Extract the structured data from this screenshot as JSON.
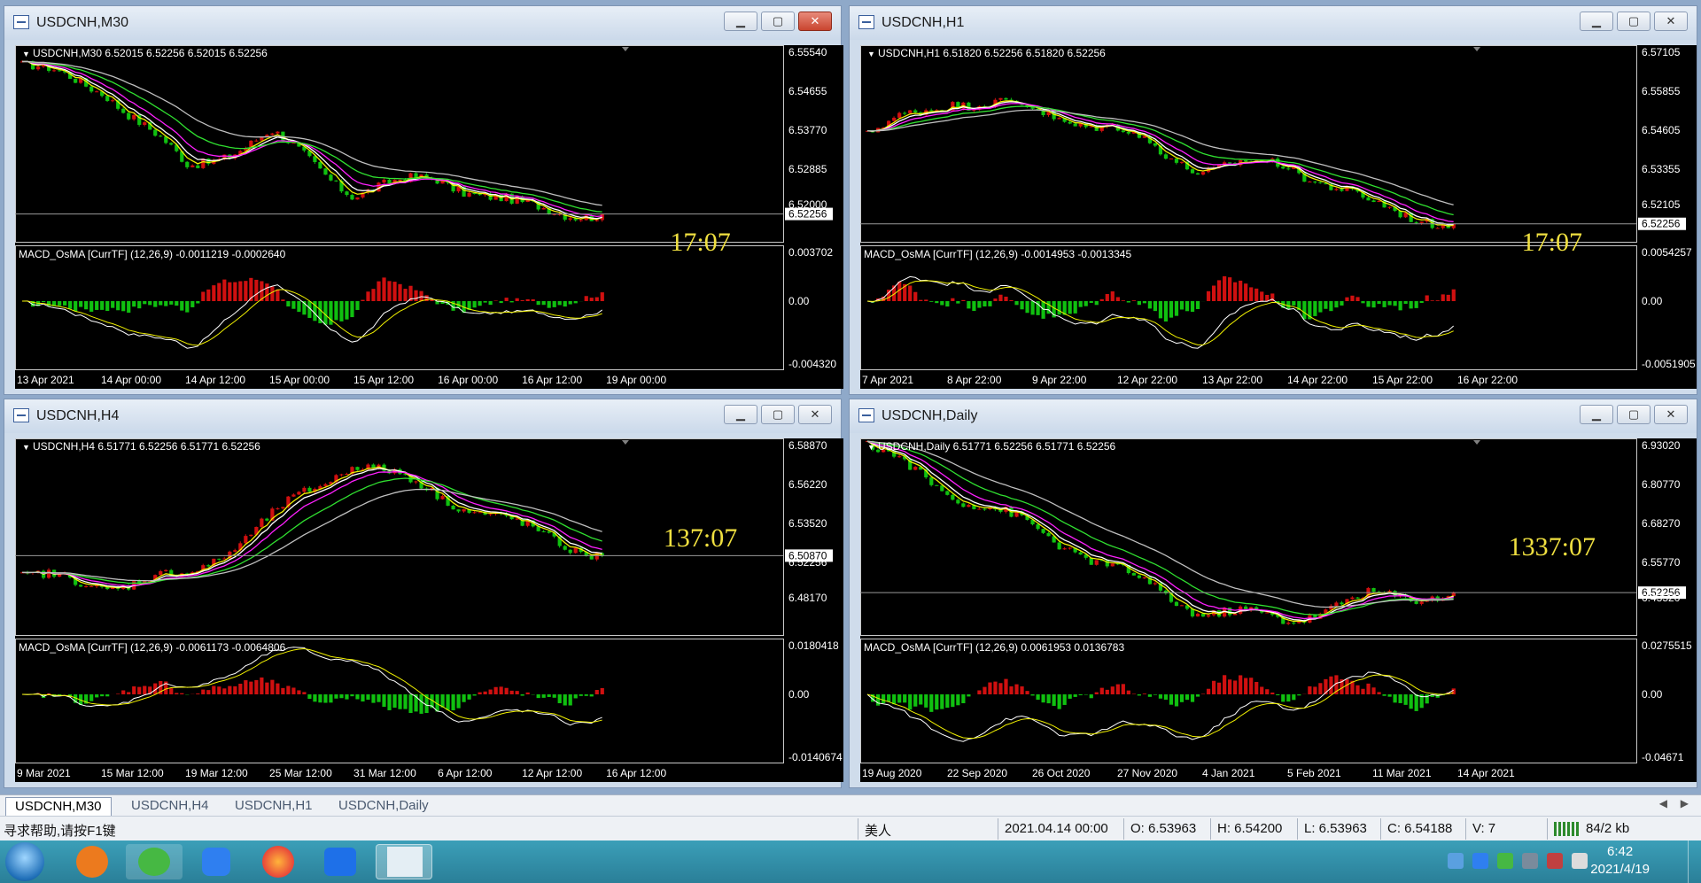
{
  "colors": {
    "bull": "#d01010",
    "bear": "#10c010",
    "ma_yellow": "#f0f000",
    "ma_white": "#ffffff",
    "ma_magenta": "#ff20ff",
    "ma_green": "#30e030",
    "ma_gray": "#bfbfbf",
    "countdown": "#f0e040"
  },
  "windows": [
    {
      "id": "m30",
      "title": "USDCNH,M30",
      "price_label": "USDCNH,M30  6.52015 6.52256 6.52015 6.52256",
      "price_axis": [
        "6.55540",
        "6.54655",
        "6.53770",
        "6.52885",
        "6.52256",
        "6.52000"
      ],
      "countdown": "17:07",
      "macd_label": "MACD_OsMA [CurrTF] (12,26,9) -0.0011219 -0.0002640",
      "macd_axis": [
        "0.003702",
        "0.00",
        "-0.004320"
      ],
      "time_axis": [
        "13 Apr 2021",
        "14 Apr 00:00",
        "14 Apr 12:00",
        "15 Apr 00:00",
        "15 Apr 12:00",
        "16 Apr 00:00",
        "16 Apr 12:00",
        "19 Apr 00:00"
      ]
    },
    {
      "id": "h1",
      "title": "USDCNH,H1",
      "price_label": "USDCNH,H1  6.51820 6.52256 6.51820 6.52256",
      "price_axis": [
        "6.57105",
        "6.55855",
        "6.54605",
        "6.53355",
        "6.52256",
        "6.52105"
      ],
      "countdown": "17:07",
      "macd_label": "MACD_OsMA [CurrTF] (12,26,9) -0.0014953 -0.0013345",
      "macd_axis": [
        "0.0054257",
        "0.00",
        "-0.0051905"
      ],
      "time_axis": [
        "7 Apr 2021",
        "8 Apr 22:00",
        "9 Apr 22:00",
        "12 Apr 22:00",
        "13 Apr 22:00",
        "14 Apr 22:00",
        "15 Apr 22:00",
        "16 Apr 22:00"
      ]
    },
    {
      "id": "h4",
      "title": "USDCNH,H4",
      "price_label": "USDCNH,H4  6.51771 6.52256 6.51771 6.52256",
      "price_axis": [
        "6.58870",
        "6.56220",
        "6.53520",
        "6.52256",
        "6.50870",
        "6.48170"
      ],
      "countdown": "137:07",
      "macd_label": "MACD_OsMA [CurrTF] (12,26,9) -0.0061173 -0.0064806",
      "macd_axis": [
        "0.0180418",
        "0.00",
        "-0.0140674"
      ],
      "time_axis": [
        "9 Mar 2021",
        "15 Mar 12:00",
        "19 Mar 12:00",
        "25 Mar 12:00",
        "31 Mar 12:00",
        "6 Apr 12:00",
        "12 Apr 12:00",
        "16 Apr 12:00"
      ]
    },
    {
      "id": "daily",
      "title": "USDCNH,Daily",
      "price_label": "USDCNH,Daily  6.51771 6.52256 6.51771 6.52256",
      "price_axis": [
        "6.93020",
        "6.80770",
        "6.68270",
        "6.55770",
        "6.52256",
        "6.43520"
      ],
      "countdown": "1337:07",
      "macd_label": "MACD_OsMA [CurrTF] (12,26,9) 0.0061953 0.0136783",
      "macd_axis": [
        "0.0275515",
        "0.00",
        "-0.04671"
      ],
      "time_axis": [
        "19 Aug 2020",
        "22 Sep 2020",
        "26 Oct 2020",
        "27 Nov 2020",
        "4 Jan 2021",
        "5 Feb 2021",
        "11 Mar 2021",
        "14 Apr 2021"
      ]
    }
  ],
  "chart_data": [
    {
      "type": "line",
      "title": "USDCNH,M30",
      "x": [
        "13 Apr 2021",
        "14 Apr 00:00",
        "14 Apr 12:00",
        "15 Apr 00:00",
        "15 Apr 12:00",
        "16 Apr 00:00",
        "16 Apr 12:00",
        "19 Apr 00:00"
      ],
      "series": [
        {
          "values": [
            6.553,
            6.548,
            6.532,
            6.539,
            6.527,
            6.53,
            6.524,
            6.5226
          ]
        }
      ],
      "ylim": [
        6.518,
        6.556
      ]
    },
    {
      "type": "line",
      "title": "USDCNH,H1",
      "x": [
        "7 Apr 2021",
        "8 Apr 22:00",
        "9 Apr 22:00",
        "12 Apr 22:00",
        "13 Apr 22:00",
        "14 Apr 22:00",
        "15 Apr 22:00",
        "16 Apr 22:00"
      ],
      "series": [
        {
          "values": [
            6.548,
            6.558,
            6.555,
            6.549,
            6.538,
            6.54,
            6.528,
            6.5226
          ]
        }
      ],
      "ylim": [
        6.519,
        6.572
      ]
    },
    {
      "type": "line",
      "title": "USDCNH,H4",
      "x": [
        "9 Mar 2021",
        "15 Mar 12:00",
        "19 Mar 12:00",
        "25 Mar 12:00",
        "31 Mar 12:00",
        "6 Apr 12:00",
        "12 Apr 12:00",
        "16 Apr 12:00"
      ],
      "series": [
        {
          "values": [
            6.51,
            6.505,
            6.51,
            6.545,
            6.58,
            6.56,
            6.54,
            6.5226
          ]
        }
      ],
      "ylim": [
        6.478,
        6.59
      ]
    },
    {
      "type": "line",
      "title": "USDCNH,Daily",
      "x": [
        "19 Aug 2020",
        "22 Sep 2020",
        "26 Oct 2020",
        "27 Nov 2020",
        "4 Jan 2021",
        "5 Feb 2021",
        "11 Mar 2021",
        "14 Apr 2021"
      ],
      "series": [
        {
          "values": [
            6.93,
            6.8,
            6.7,
            6.58,
            6.47,
            6.45,
            6.51,
            6.5226
          ]
        }
      ],
      "ylim": [
        6.42,
        6.935
      ]
    }
  ],
  "tabs": [
    "USDCNH,M30",
    "USDCNH,H4",
    "USDCNH,H1",
    "USDCNH,Daily"
  ],
  "status": {
    "help": "寻求帮助,请按F1键",
    "profile": "美人",
    "datetime": "2021.04.14 00:00",
    "open": "O: 6.53963",
    "high": "H: 6.54200",
    "low": "L: 6.53963",
    "close": "C: 6.54188",
    "volume": "V: 7",
    "traffic": "84/2 kb"
  },
  "taskbar": {
    "time": "6:42",
    "date": "2021/4/19"
  }
}
